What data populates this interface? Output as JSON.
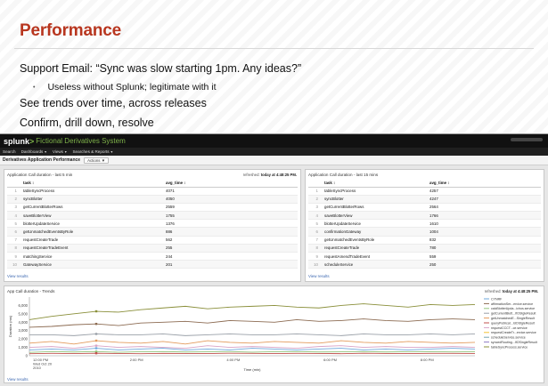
{
  "slide": {
    "title": "Performance",
    "bullets": [
      "Support Email: “Sync was slow starting 1pm. Any ideas?”",
      "See trends over time, across releases",
      "Confirm, drill down, resolve"
    ],
    "sub_bullet": "Useless without Splunk; legitimate with it"
  },
  "app": {
    "logo_text": "splunk",
    "logo_gt": ">",
    "app_name": "Fictional Derivatives System",
    "nav": [
      "Search",
      "Dashboards",
      "Views",
      "Searches & Reports"
    ],
    "nav_caret": "▼",
    "page_title": "Derivatives Application Performance",
    "actions_label": "Actions ▼",
    "colors": {
      "brand_green": "#7fb34a",
      "topbar": "#111111",
      "link": "#3a66b0"
    }
  },
  "panel_left": {
    "title": "Application Call duration - last 5 min",
    "refreshed_label": "refreshed:",
    "refreshed_time": "today at 4:48:25 PM.",
    "col_task": "task ↕",
    "col_avg": "avg_time ↕",
    "rows": [
      {
        "n": "1",
        "task": "tableSyncProcess",
        "avg": "4071"
      },
      {
        "n": "2",
        "task": "syncBlotter",
        "avg": "4050"
      },
      {
        "n": "3",
        "task": "getCurrentBlotterRows",
        "avg": "2559"
      },
      {
        "n": "4",
        "task": "saveBlotterView",
        "avg": "1755"
      },
      {
        "n": "5",
        "task": "blotterUpdateService",
        "avg": "1376"
      },
      {
        "n": "6",
        "task": "getUnmatchedEventsByRole",
        "avg": "886"
      },
      {
        "n": "7",
        "task": "requestCreateTrade",
        "avg": "562"
      },
      {
        "n": "8",
        "task": "requestCreateTradeEvent",
        "avg": "255"
      },
      {
        "n": "9",
        "task": "matchingService",
        "avg": "244"
      },
      {
        "n": "10",
        "task": "GatewayService",
        "avg": "201"
      }
    ],
    "view_results": "View results"
  },
  "panel_right": {
    "title": "Application Call duration - last 15 mins",
    "col_task": "task ↕",
    "col_avg": "avg_time ↕",
    "rows": [
      {
        "n": "1",
        "task": "tableSyncProcess",
        "avg": "4257"
      },
      {
        "n": "2",
        "task": "syncBlotter",
        "avg": "4247"
      },
      {
        "n": "3",
        "task": "getCurrentBlotterRows",
        "avg": "2564"
      },
      {
        "n": "4",
        "task": "saveBlotterView",
        "avg": "1766"
      },
      {
        "n": "5",
        "task": "blotterUpdateService",
        "avg": "1610"
      },
      {
        "n": "6",
        "task": "confirmationGateway",
        "avg": "1004"
      },
      {
        "n": "7",
        "task": "getUnmatchedEventsByRole",
        "avg": "832"
      },
      {
        "n": "8",
        "task": "requestCreateTrade",
        "avg": "780"
      },
      {
        "n": "9",
        "task": "requestAmendTradeEvent",
        "avg": "559"
      },
      {
        "n": "10",
        "task": "scheduleService",
        "avg": "250"
      }
    ],
    "view_results": "View results"
  },
  "panel_chart": {
    "title": "App Call duration - Trends",
    "refreshed_label": "refreshed:",
    "refreshed_time": "today at 4:48:25 PM.",
    "view_results": "View results"
  },
  "chart_data": {
    "type": "line",
    "title": "App Call duration - Trends",
    "xlabel": "Time (min)",
    "ylabel": "Duration (ms)",
    "ylim": [
      0,
      7000
    ],
    "yticks": [
      "0",
      "1,000",
      "2,000",
      "3,000",
      "4,000",
      "5,000",
      "6,000"
    ],
    "xticks": [
      "12:00 PM\nWed Oct 20\n2010",
      "2:00 PM",
      "4:00 PM",
      "6:00 PM",
      "8:00 PM"
    ],
    "x": [
      0,
      1,
      2,
      3,
      4,
      5,
      6,
      7,
      8,
      9,
      10,
      11,
      12,
      13,
      14,
      15,
      16,
      17,
      18,
      19,
      20
    ],
    "series": [
      {
        "name": "tableSyncProcess",
        "color": "#8a8f3a",
        "values": [
          4300,
          4700,
          5000,
          5300,
          5200,
          5500,
          5700,
          5900,
          5600,
          5800,
          5900,
          6000,
          5800,
          5700,
          6000,
          6200,
          6000,
          5800,
          6100,
          6000,
          6100
        ]
      },
      {
        "name": "syncBlotter",
        "color": "#8c6b52",
        "values": [
          3400,
          3500,
          3700,
          3800,
          3600,
          3900,
          4000,
          4100,
          3900,
          4200,
          4100,
          4000,
          4300,
          4100,
          4200,
          4400,
          4200,
          4100,
          4300,
          4400,
          4300
        ]
      },
      {
        "name": "getCurrentBlotterRows",
        "color": "#9aa0a8",
        "values": [
          2500,
          2500,
          2400,
          2600,
          2500,
          2500,
          2600,
          2400,
          2500,
          2600,
          2500,
          2500,
          2600,
          2500,
          2400,
          2600,
          2500,
          2500,
          2600,
          2500,
          2600
        ]
      },
      {
        "name": "getUnmatchedEventsByRole",
        "color": "#e39a5c",
        "values": [
          1500,
          1700,
          1400,
          1800,
          1600,
          1500,
          1700,
          1400,
          1800,
          1600,
          1500,
          1700,
          1600,
          1500,
          1800,
          1600,
          1500,
          1700,
          1600,
          1500,
          1600
        ]
      },
      {
        "name": "requestCreateTrade",
        "color": "#d9a3c6",
        "values": [
          1000,
          1100,
          900,
          1200,
          1000,
          1100,
          1000,
          900,
          1200,
          1000,
          1100,
          1000,
          900,
          1100,
          1200,
          1000,
          1100,
          1000,
          1000,
          1100,
          1000
        ]
      },
      {
        "name": "confirmationGateway",
        "color": "#6fa8dc",
        "values": [
          700,
          800,
          700,
          900,
          700,
          800,
          900,
          700,
          800,
          700,
          900,
          800,
          700,
          800,
          900,
          700,
          800,
          700,
          800,
          900,
          800
        ]
      },
      {
        "name": "matchingService",
        "color": "#93c47d",
        "values": [
          400,
          500,
          450,
          500,
          420,
          480,
          500,
          450,
          470,
          500,
          430,
          480,
          500,
          450,
          470,
          500,
          450,
          480,
          500,
          460,
          480
        ]
      },
      {
        "name": "GatewayService",
        "color": "#c0504d",
        "values": [
          250,
          280,
          260,
          300,
          270,
          250,
          290,
          270,
          260,
          300,
          280,
          260,
          290,
          270,
          250,
          300,
          270,
          260,
          290,
          280,
          270
        ]
      }
    ],
    "legend": [
      "CYNRF",
      "affirmationSer...ervice.service",
      "calcBlotterUpda...ichos.service",
      "getCurrentBlott...IfOStgleResult",
      "getUnmatchedE...SingleResult",
      "queryPublicat...IdOStgleResult",
      "requestCCCT...ce.service",
      "requestCreateTr...ervice.service",
      "scheduleService.service",
      "syncedRouting...IfOSingleResult",
      "tableSyncProcess.service"
    ],
    "legend_colors": [
      "#6fa8dc",
      "#8c6b52",
      "#93c47d",
      "#9aa0a8",
      "#e39a5c",
      "#c0504d",
      "#d9a3c6",
      "#f1c232",
      "#76a5af",
      "#8e7cc3",
      "#8a8f3a"
    ],
    "legend_placement": "right",
    "grid": false
  }
}
